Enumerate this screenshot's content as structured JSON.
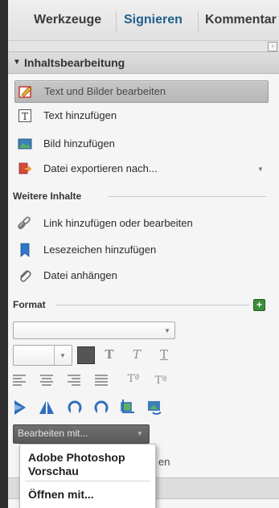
{
  "tabs": [
    "Werkzeuge",
    "Signieren",
    "Kommentar"
  ],
  "panel": {
    "menu_icon": "panel-options-icon",
    "section": {
      "title": "Inhaltsbearbeitung",
      "expanded_icon": "triangle-down-icon"
    },
    "items": [
      {
        "label": "Text und Bilder bearbeiten",
        "icon": "edit-text-images-icon",
        "selected": true
      },
      {
        "label": "Text hinzufügen",
        "icon": "add-text-icon"
      },
      {
        "label": "Bild hinzufügen",
        "icon": "add-image-icon"
      },
      {
        "label": "Datei exportieren nach...",
        "icon": "export-file-icon",
        "has_dropdown": true
      }
    ],
    "more_content": {
      "title": "Weitere Inhalte",
      "items": [
        {
          "label": "Link hinzufügen oder bearbeiten",
          "icon": "link-icon"
        },
        {
          "label": "Lesezeichen hinzufügen",
          "icon": "bookmark-icon"
        },
        {
          "label": "Datei anhängen",
          "icon": "paperclip-icon"
        }
      ]
    },
    "format": {
      "title": "Format",
      "expand_icon": "plus-box-icon",
      "expand_label": "+",
      "font_select_value": "",
      "size_select_value": "",
      "style_glyphs": [
        "T",
        "T",
        "T"
      ],
      "superscript_glyph": "Tª",
      "subscript_glyph": "Tª"
    },
    "edit_with": {
      "label": "Bearbeiten mit...",
      "behind_text": "en"
    },
    "popup": {
      "options": [
        "Adobe Photoshop\nVorschau",
        "Öffnen mit..."
      ]
    }
  },
  "colors": {
    "active_tab": "#1f5f8c",
    "tab_text": "#3b3b3b",
    "expand_green": "#3a8f3a"
  }
}
